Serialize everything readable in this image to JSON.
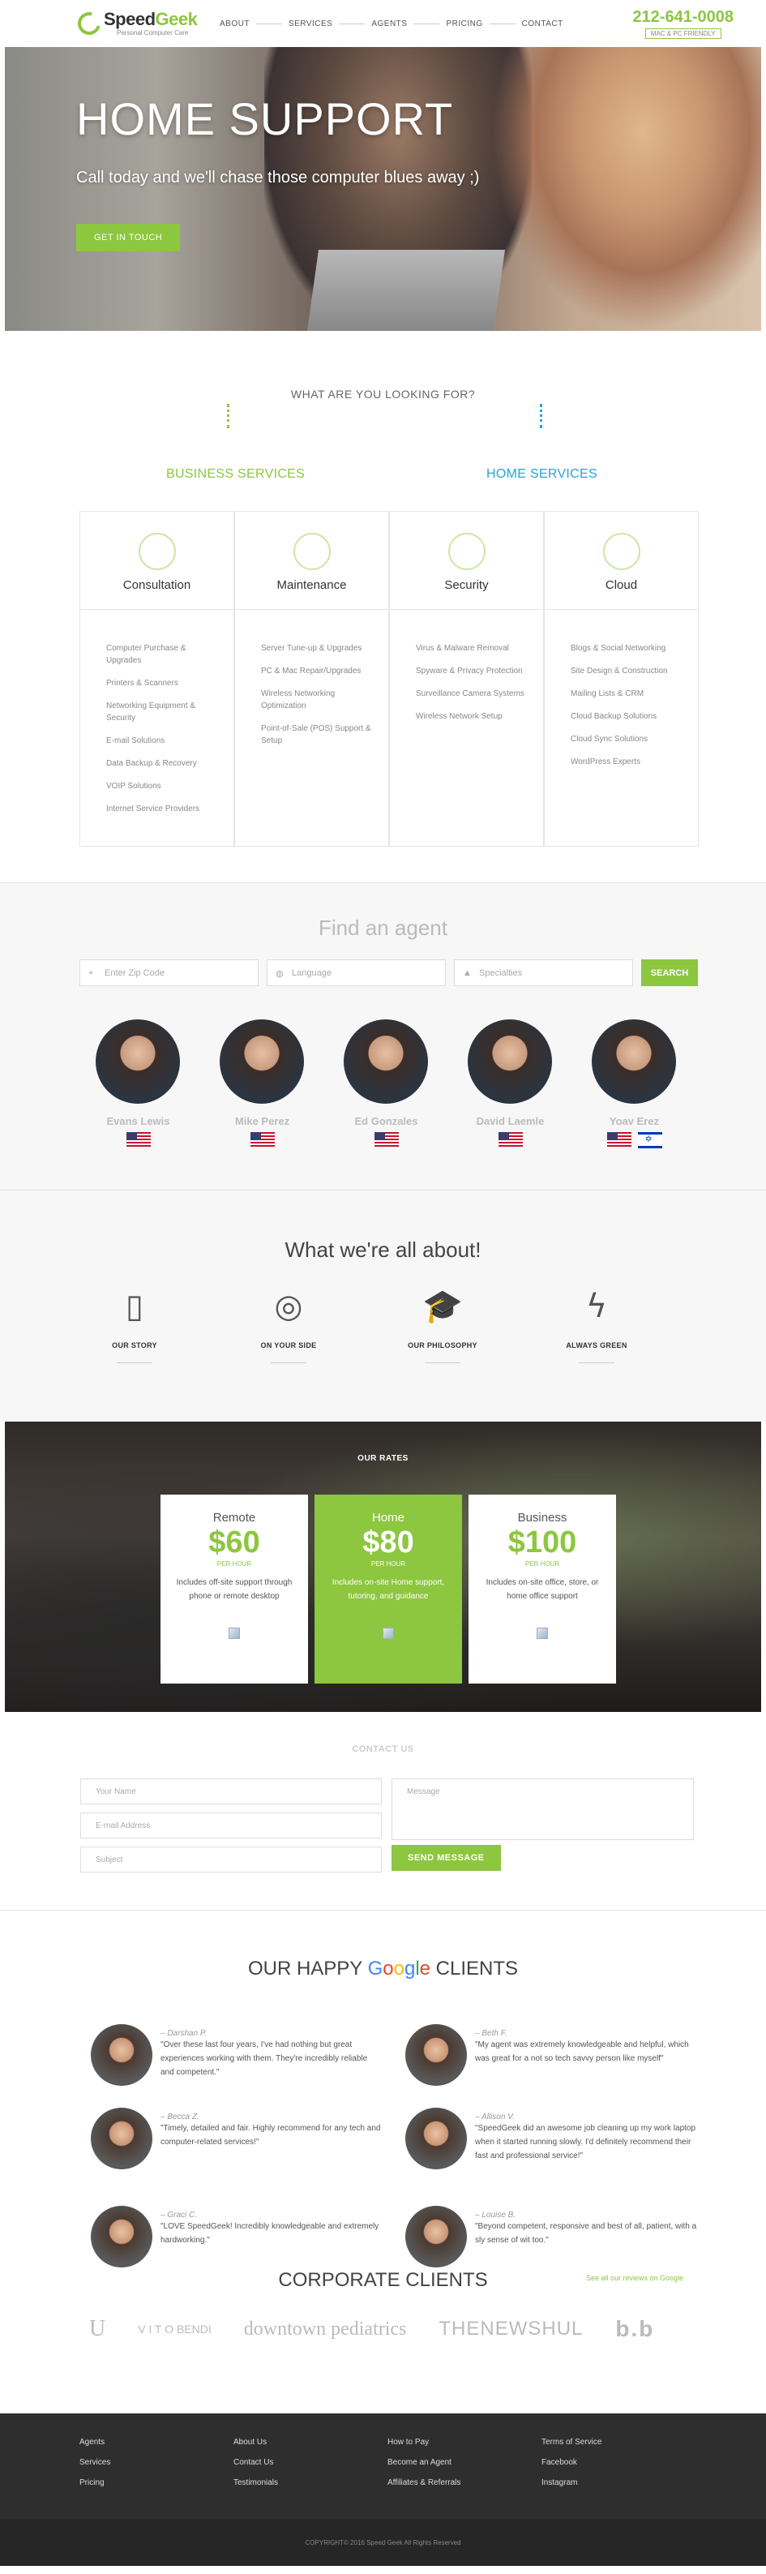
{
  "header": {
    "logo_name_a": "Speed",
    "logo_name_b": "Geek",
    "logo_sub": "Personal Computer Care",
    "nav": [
      "ABOUT",
      "SERVICES",
      "AGENTS",
      "PRICING",
      "CONTACT"
    ],
    "phone": "212-641-0008",
    "friendly": "MAC & PC FRIENDLY"
  },
  "hero": {
    "title": "HOME SUPPORT",
    "tagline": "Call today and we'll chase those computer blues away ;)",
    "cta": "GET IN TOUCH"
  },
  "looking": {
    "question": "WHAT ARE YOU LOOKING FOR?",
    "business_label": "BUSINESS SERVICES",
    "home_label": "HOME SERVICES",
    "cards": [
      {
        "title": "Consultation",
        "items": [
          "Computer Purchase & Upgrades",
          "Printers & Scanners",
          "Networking Equipment & Security",
          "E-mail Solutions",
          "Data Backup & Recovery",
          "VOIP Solutions",
          "Internet Service Providers"
        ]
      },
      {
        "title": "Maintenance",
        "items": [
          "Server Tune-up & Upgrades",
          "PC & Mac Repair/Upgrades",
          "Wireless Networking Optimization",
          "Point-of-Sale (POS) Support & Setup"
        ]
      },
      {
        "title": "Security",
        "items": [
          "Virus & Malware Removal",
          "Spyware & Privacy Protection",
          "Surveillance Camera Systems",
          "Wireless Network Setup"
        ]
      },
      {
        "title": "Cloud",
        "items": [
          "Blogs & Social Networking",
          "Site Design & Construction",
          "Mailing Lists & CRM",
          "Cloud Backup Solutions",
          "Cloud Sync Solutions",
          "WordPress Experts"
        ]
      }
    ]
  },
  "agent_search": {
    "title": "Find an agent",
    "zip_placeholder": "Enter Zip Code",
    "language_placeholder": "Language",
    "specialties_placeholder": "Specialties",
    "button": "SEARCH",
    "agents": [
      {
        "name": "Evans Lewis",
        "flags": [
          "us"
        ]
      },
      {
        "name": "Mike Perez",
        "flags": [
          "us"
        ]
      },
      {
        "name": "Ed Gonzales",
        "flags": [
          "us"
        ]
      },
      {
        "name": "David Laemle",
        "flags": [
          "us"
        ]
      },
      {
        "name": "Yoav Erez",
        "flags": [
          "us",
          "il"
        ]
      }
    ]
  },
  "about": {
    "title": "What we're all about!",
    "items": [
      {
        "label": "OUR STORY",
        "icon": "book-icon",
        "glyph": "▯"
      },
      {
        "label": "ON YOUR SIDE",
        "icon": "lifebuoy-icon",
        "glyph": "◎"
      },
      {
        "label": "OUR PHILOSOPHY",
        "icon": "graduation-cap-icon",
        "glyph": "🎓"
      },
      {
        "label": "ALWAYS GREEN",
        "icon": "lightning-icon",
        "glyph": "ϟ"
      }
    ]
  },
  "rates": {
    "title": "OUR RATES",
    "plans": [
      {
        "name": "Remote",
        "price": "$60",
        "unit": "PER HOUR",
        "desc": "Includes off-site support through phone or remote desktop"
      },
      {
        "name": "Home",
        "price": "$80",
        "unit": "PER HOUR",
        "desc": "Includes on-site Home support, tutoring, and guidance"
      },
      {
        "name": "Business",
        "price": "$100",
        "unit": "PER HOUR",
        "desc": "Includes on-site office, store, or home office support"
      }
    ]
  },
  "contact": {
    "title": "CONTACT US",
    "name_placeholder": "Your Name",
    "email_placeholder": "E-mail Address",
    "subject_placeholder": "Subject",
    "message_placeholder": "Message",
    "button": "SEND MESSAGE"
  },
  "reviews": {
    "title_a": "OUR HAPPY ",
    "title_google": "Google",
    "title_b": " CLIENTS",
    "items": [
      {
        "name": "– Darshan P.",
        "text": "\"Over these last four years, I've had nothing but great experiences working with them. They're incredibly reliable and competent.\""
      },
      {
        "name": "– Beth F.",
        "text": "\"My agent was extremely knowledgeable and helpful, which was great for a not so tech savvy person like myself\""
      },
      {
        "name": "– Becca Z.",
        "text": "\"Timely, detailed and fair. Highly recommend for any tech and computer-related services!\""
      },
      {
        "name": "– Allison V.",
        "text": "\"SpeedGeek did an awesome job cleaning up my work laptop when it started running slowly. I'd definitely recommend their fast and professional service!\""
      },
      {
        "name": "– Graci C.",
        "text": "\"LOVE SpeedGeek! Incredibly knowledgeable and extremely hardworking.\""
      },
      {
        "name": "– Louise B.",
        "text": "\"Beyond competent, responsive and best of all, patient, with a sly sense of wit too.\""
      }
    ],
    "see_all": "See all our reviews on Google"
  },
  "corporate": {
    "title": "CORPORATE CLIENTS",
    "logos": [
      "U",
      "V I T O BENDI",
      "downtown pediatrics",
      "THENEWSHUL",
      "b.b"
    ]
  },
  "footer": {
    "columns": [
      [
        "Agents",
        "Services",
        "Pricing"
      ],
      [
        "About Us",
        "Contact Us",
        "Testimonials"
      ],
      [
        "How to Pay",
        "Become an Agent",
        "Affiliates & Referrals"
      ],
      [
        "Terms of Service",
        "Facebook",
        "Instagram"
      ]
    ],
    "copyright": "COPYRIGHT© 2016 Speed Geek All Rights Reserved"
  },
  "colors": {
    "accent_green": "#8dc63f",
    "accent_blue": "#29a3d9",
    "footer_bg": "#2e2e2e"
  }
}
